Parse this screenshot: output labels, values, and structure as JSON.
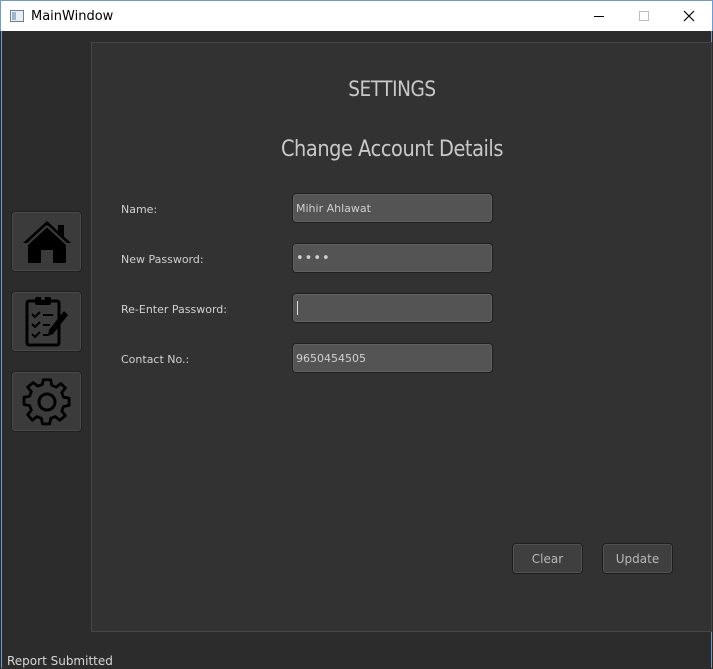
{
  "window": {
    "title": "MainWindow",
    "controls": [
      "minimize-icon",
      "maximize-icon",
      "close-icon"
    ]
  },
  "sidebar": {
    "items": [
      {
        "name": "home",
        "icon": "home-icon"
      },
      {
        "name": "report",
        "icon": "clipboard-icon"
      },
      {
        "name": "settings",
        "icon": "gear-icon"
      }
    ]
  },
  "main": {
    "title": "SETTINGS",
    "subtitle": "Change Account Details",
    "form": {
      "name_label": "Name:",
      "name_value": "Mihir Ahlawat",
      "new_password_label": "New Password:",
      "new_password_value": "••••",
      "reenter_password_label": "Re-Enter Password:",
      "reenter_password_value": "",
      "contact_label": "Contact No.:",
      "contact_value": "9650454505"
    },
    "buttons": {
      "clear": "Clear",
      "update": "Update"
    }
  },
  "statusbar": {
    "message": "Report Submitted"
  },
  "colors": {
    "background": "#2c2c2c",
    "panel": "#323232",
    "field": "#545454",
    "text": "#d0d0d0"
  }
}
